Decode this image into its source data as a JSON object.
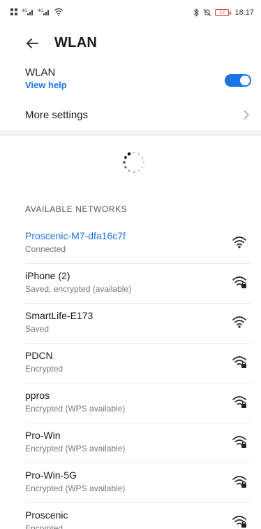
{
  "status_bar": {
    "time": "18:17",
    "battery_level": "17",
    "left_icons": [
      "sim-icon",
      "signal-4g-icon",
      "signal-icon",
      "wifi-status-icon"
    ],
    "right_icons": [
      "bluetooth-icon",
      "mute-icon",
      "battery-icon"
    ]
  },
  "header": {
    "title": "WLAN"
  },
  "wlan_toggle": {
    "label": "WLAN",
    "help_link": "View help",
    "enabled": true,
    "accent": "#1a73e8"
  },
  "more_settings": {
    "label": "More settings"
  },
  "networks_section": {
    "header": "AVAILABLE NETWORKS",
    "networks": [
      {
        "name": "Proscenic-M7-dfa16c7f",
        "status": "Connected",
        "locked": false,
        "connected": true
      },
      {
        "name": "iPhone (2)",
        "status": "Saved, encrypted (available)",
        "locked": true,
        "connected": false
      },
      {
        "name": "SmartLife-E173",
        "status": "Saved",
        "locked": false,
        "connected": false
      },
      {
        "name": "PDCN",
        "status": "Encrypted",
        "locked": true,
        "connected": false
      },
      {
        "name": "ppros",
        "status": "Encrypted (WPS available)",
        "locked": true,
        "connected": false
      },
      {
        "name": "Pro-Win",
        "status": "Encrypted (WPS available)",
        "locked": true,
        "connected": false
      },
      {
        "name": "Pro-Win-5G",
        "status": "Encrypted (WPS available)",
        "locked": true,
        "connected": false
      },
      {
        "name": "Proscenic",
        "status": "Encrypted",
        "locked": true,
        "connected": false
      }
    ]
  }
}
